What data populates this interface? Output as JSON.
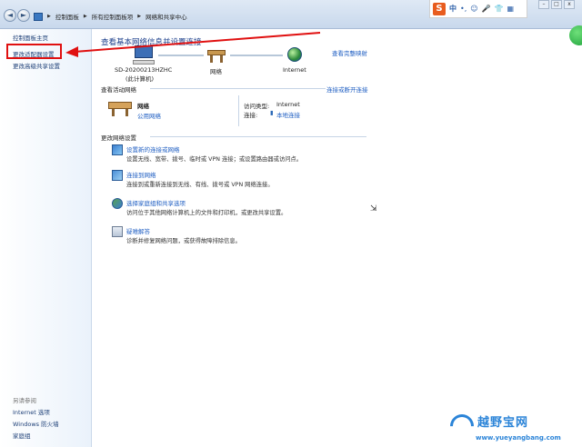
{
  "address_bar": {
    "back": "◄",
    "forward": "►",
    "breadcrumbs": [
      "控制面板",
      "所有控制面板项",
      "网络和共享中心"
    ]
  },
  "ime": {
    "logo": "S",
    "lang": "中",
    "punct": "•,",
    "emoji": "☺",
    "mic": "🎤",
    "skin": "👕",
    "grid": "▦"
  },
  "sidebar": {
    "home": "控制面板主页",
    "adapter": "更改适配器设置",
    "advanced": "更改高级共享设置",
    "see_also_title": "另请参阅",
    "see_also": [
      "Internet 选项",
      "Windows 防火墙",
      "家庭组"
    ]
  },
  "main": {
    "headline": "查看基本网络信息并设置连接",
    "full_map": "查看完整映射",
    "computer_name": "SD-20200213HZHC",
    "computer_sub": "(此计算机)",
    "network_label": "网络",
    "internet_label": "Internet",
    "active_title": "查看活动网络",
    "connect_link": "连接或断开连接",
    "active_net_name": "网络",
    "active_net_type": "公用网络",
    "access_type_label": "访问类型:",
    "access_type_value": "Internet",
    "connection_label": "连接:",
    "connection_value": "本地连接",
    "change_title": "更改网络设置",
    "tasks": [
      {
        "title": "设置新的连接或网络",
        "desc": "设置无线、宽带、拨号、临时或 VPN 连接；或设置路由器或访问点。"
      },
      {
        "title": "连接到网络",
        "desc": "连接到或重新连接到无线、有线、拨号或 VPN 网络连接。"
      },
      {
        "title": "选择家庭组和共享选项",
        "desc": "访问位于其他网络计算机上的文件和打印机，或更改共享设置。"
      },
      {
        "title": "疑难解答",
        "desc": "诊断并修复网络问题，或获得故障排除信息。"
      }
    ]
  },
  "watermark": {
    "brand": "越野宝网",
    "url": "www.yueyangbang.com"
  },
  "colors": {
    "annotation_red": "#e01010",
    "link_blue": "#1d5dc2",
    "heading_blue": "#1a3d8a"
  }
}
